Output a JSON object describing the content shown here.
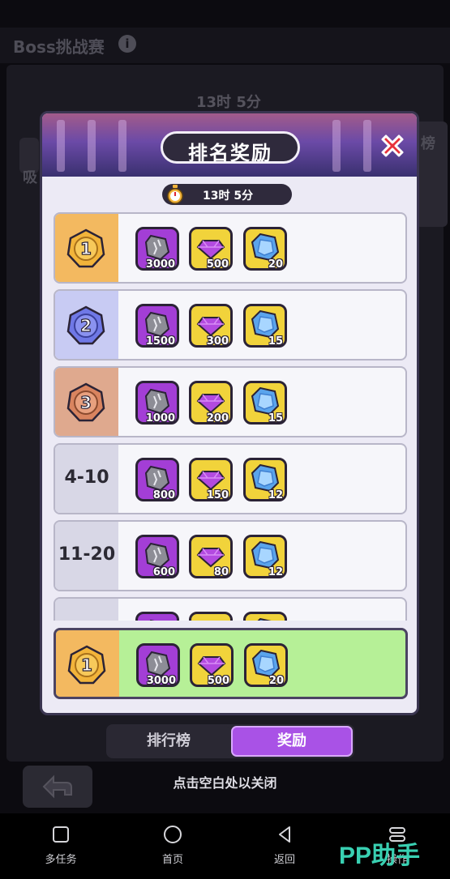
{
  "background": {
    "title": "Boss挑战赛",
    "timer": "13时 5分",
    "side_left": "吸",
    "side_right": "榜"
  },
  "modal": {
    "title": "排名奖励",
    "timer": "13时 5分",
    "rows": [
      {
        "rank": "1",
        "badge": "gold",
        "rewards": [
          {
            "type": "stone",
            "qty": "3000"
          },
          {
            "type": "gem",
            "qty": "500"
          },
          {
            "type": "crystal",
            "qty": "20"
          }
        ]
      },
      {
        "rank": "2",
        "badge": "silver",
        "rewards": [
          {
            "type": "stone",
            "qty": "1500"
          },
          {
            "type": "gem",
            "qty": "300"
          },
          {
            "type": "crystal",
            "qty": "15"
          }
        ]
      },
      {
        "rank": "3",
        "badge": "bronze",
        "rewards": [
          {
            "type": "stone",
            "qty": "1000"
          },
          {
            "type": "gem",
            "qty": "200"
          },
          {
            "type": "crystal",
            "qty": "15"
          }
        ]
      },
      {
        "rank": "4-10",
        "badge": "none",
        "rewards": [
          {
            "type": "stone",
            "qty": "800"
          },
          {
            "type": "gem",
            "qty": "150"
          },
          {
            "type": "crystal",
            "qty": "12"
          }
        ]
      },
      {
        "rank": "11-20",
        "badge": "none",
        "rewards": [
          {
            "type": "stone",
            "qty": "600"
          },
          {
            "type": "gem",
            "qty": "80"
          },
          {
            "type": "crystal",
            "qty": "12"
          }
        ]
      },
      {
        "rank": "",
        "badge": "none",
        "rewards": [
          {
            "type": "stone",
            "qty": ""
          },
          {
            "type": "gem",
            "qty": ""
          },
          {
            "type": "crystal",
            "qty": ""
          }
        ]
      }
    ],
    "my_row": {
      "rank": "1",
      "badge": "gold",
      "rewards": [
        {
          "type": "stone",
          "qty": "3000"
        },
        {
          "type": "gem",
          "qty": "500"
        },
        {
          "type": "crystal",
          "qty": "20"
        }
      ]
    }
  },
  "tabs": {
    "leaderboard": "排行榜",
    "rewards": "奖励",
    "active": "rewards"
  },
  "hint": "点击空白处以关闭",
  "navbar": {
    "multitask": "多任务",
    "home": "首页",
    "back": "返回",
    "menu": "操作"
  },
  "watermark": "PP助手",
  "colors": {
    "gold": "#f2b43a",
    "silver": "#6f78e6",
    "bronze": "#d9845f",
    "stone_bg": "#a33ed6",
    "gem_bg": "#f1d33b",
    "active_tab": "#a952e6",
    "my_row": "#b6f097"
  },
  "icons": {
    "close": "close-x-icon",
    "clock": "stopwatch-icon",
    "back": "back-arrow-icon"
  }
}
